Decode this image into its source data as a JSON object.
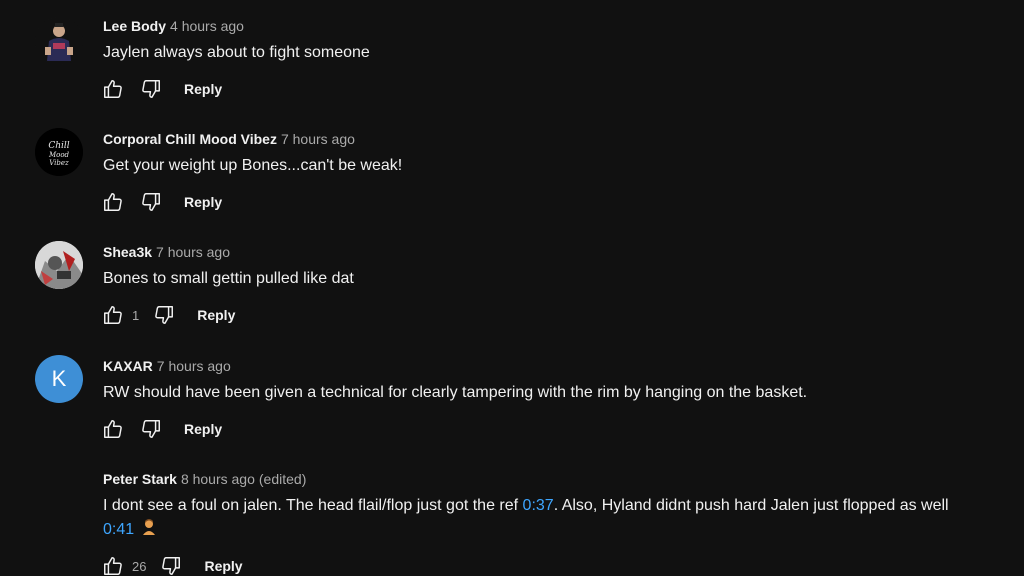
{
  "comments": [
    {
      "author": "Lee Body",
      "time": "4 hours ago",
      "text": "Jaylen always about to fight someone",
      "likes": "",
      "reply_label": "Reply"
    },
    {
      "author": "Corporal Chill Mood Vibez",
      "time": "7 hours ago",
      "text": "Get your weight up Bones...can't be weak!",
      "likes": "",
      "reply_label": "Reply"
    },
    {
      "author": "Shea3k",
      "time": "7 hours ago",
      "text": "Bones to small gettin pulled like dat",
      "likes": "1",
      "reply_label": "Reply"
    },
    {
      "author": "KAXAR",
      "avatar_letter": "K",
      "time": "7 hours ago",
      "text": "RW should have been given a technical for clearly tampering with the rim by hanging on the basket.",
      "likes": "",
      "reply_label": "Reply"
    },
    {
      "author": "Peter Stark",
      "time": "8 hours ago",
      "edited": "(edited)",
      "text_part1": "I dont see a foul on jalen. The head flail/flop just got the ref ",
      "timestamp1": "0:37",
      "text_part2": ". Also, Hyland didnt push hard Jalen just flopped as well ",
      "timestamp2": "0:41",
      "likes": "26",
      "reply_label": "Reply"
    }
  ],
  "colors": {
    "background": "#111111",
    "text": "#f1f1f1",
    "secondary": "#aaaaaa",
    "link": "#3ea6ff",
    "avatar_blue": "#3e8fd6"
  },
  "icons": {
    "like": "thumb-up-icon",
    "dislike": "thumb-down-icon",
    "emoji": "person-emoji-icon"
  }
}
